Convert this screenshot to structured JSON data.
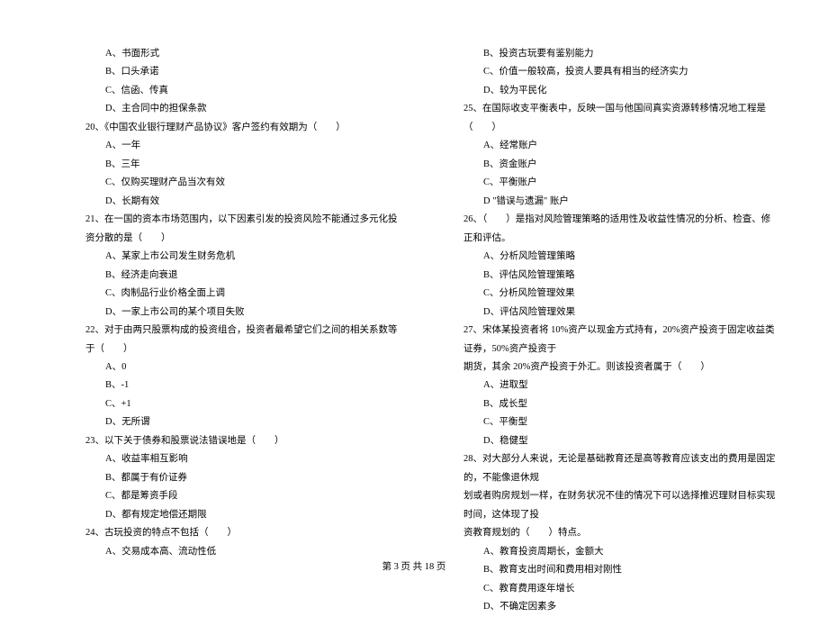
{
  "left": {
    "q19": {
      "a": "A、书面形式",
      "b": "B、口头承诺",
      "c": "C、信函、传真",
      "d": "D、主合同中的担保条款"
    },
    "q20": {
      "stem": "20、《中国农业银行理财产品协议》客户签约有效期为（　　）",
      "a": "A、一年",
      "b": "B、三年",
      "c": "C、仅购买理财产品当次有效",
      "d": "D、长期有效"
    },
    "q21": {
      "stem": "21、在一国的资本市场范围内，以下因素引发的投资风险不能通过多元化投资分散的是（　　）",
      "a": "A、某家上市公司发生财务危机",
      "b": "B、经济走向衰退",
      "c": "C、肉制品行业价格全面上调",
      "d": "D、一家上市公司的某个项目失败"
    },
    "q22": {
      "stem": "22、对于由两只股票构成的投资组合，投资者最希望它们之间的相关系数等于（　　）",
      "a": "A、0",
      "b": "B、-1",
      "c": "C、+1",
      "d": "D、无所谓"
    },
    "q23": {
      "stem": "23、以下关于债券和股票说法错误地是（　　）",
      "a": "A、收益率相互影响",
      "b": "B、都属于有价证券",
      "c": "C、都是筹资手段",
      "d": "D、都有规定地偿还期限"
    },
    "q24": {
      "stem": "24、古玩投资的特点不包括（　　）",
      "a": "A、交易成本高、流动性低"
    }
  },
  "right": {
    "q24": {
      "b": "B、投资古玩要有鉴别能力",
      "c": "C、价值一般较高，投资人要具有相当的经济实力",
      "d": "D、较为平民化"
    },
    "q25": {
      "stem": "25、在国际收支平衡表中，反映一国与他国间真实资源转移情况地工程是（　　）",
      "a": "A、经常账户",
      "b": "B、资金账户",
      "c": "C、平衡账户",
      "d": "D \"错误与遗漏\" 账户"
    },
    "q26": {
      "stem": "26、（　　）是指对风险管理策略的适用性及收益性情况的分析、检查、修正和评估。",
      "a": "A、分析风险管理策略",
      "b": "B、评估风险管理策略",
      "c": "C、分析风险管理效果",
      "d": "D、评估风险管理效果"
    },
    "q27": {
      "stem1": "27、宋体某投资者将 10%资产以现金方式持有，20%资产投资于固定收益类证券，50%资产投资于",
      "stem2": "期货，其余 20%资产投资于外汇。则该投资者属于（　　）",
      "a": "A、进取型",
      "b": "B、成长型",
      "c": "C、平衡型",
      "d": "D、稳健型"
    },
    "q28": {
      "stem1": "28、对大部分人来说，无论是基础教育还是高等教育应该支出的费用是固定的，不能像退休规",
      "stem2": "划或者购房规划一样，在财务状况不佳的情况下可以选择推迟理财目标实现时间，这体现了投",
      "stem3": "资教育规划的（　　）特点。",
      "a": "A、教育投资周期长，金额大",
      "b": "B、教育支出时间和费用相对刚性",
      "c": "C、教育费用逐年增长",
      "d": "D、不确定因素多"
    }
  },
  "footer": "第 3 页 共 18 页"
}
